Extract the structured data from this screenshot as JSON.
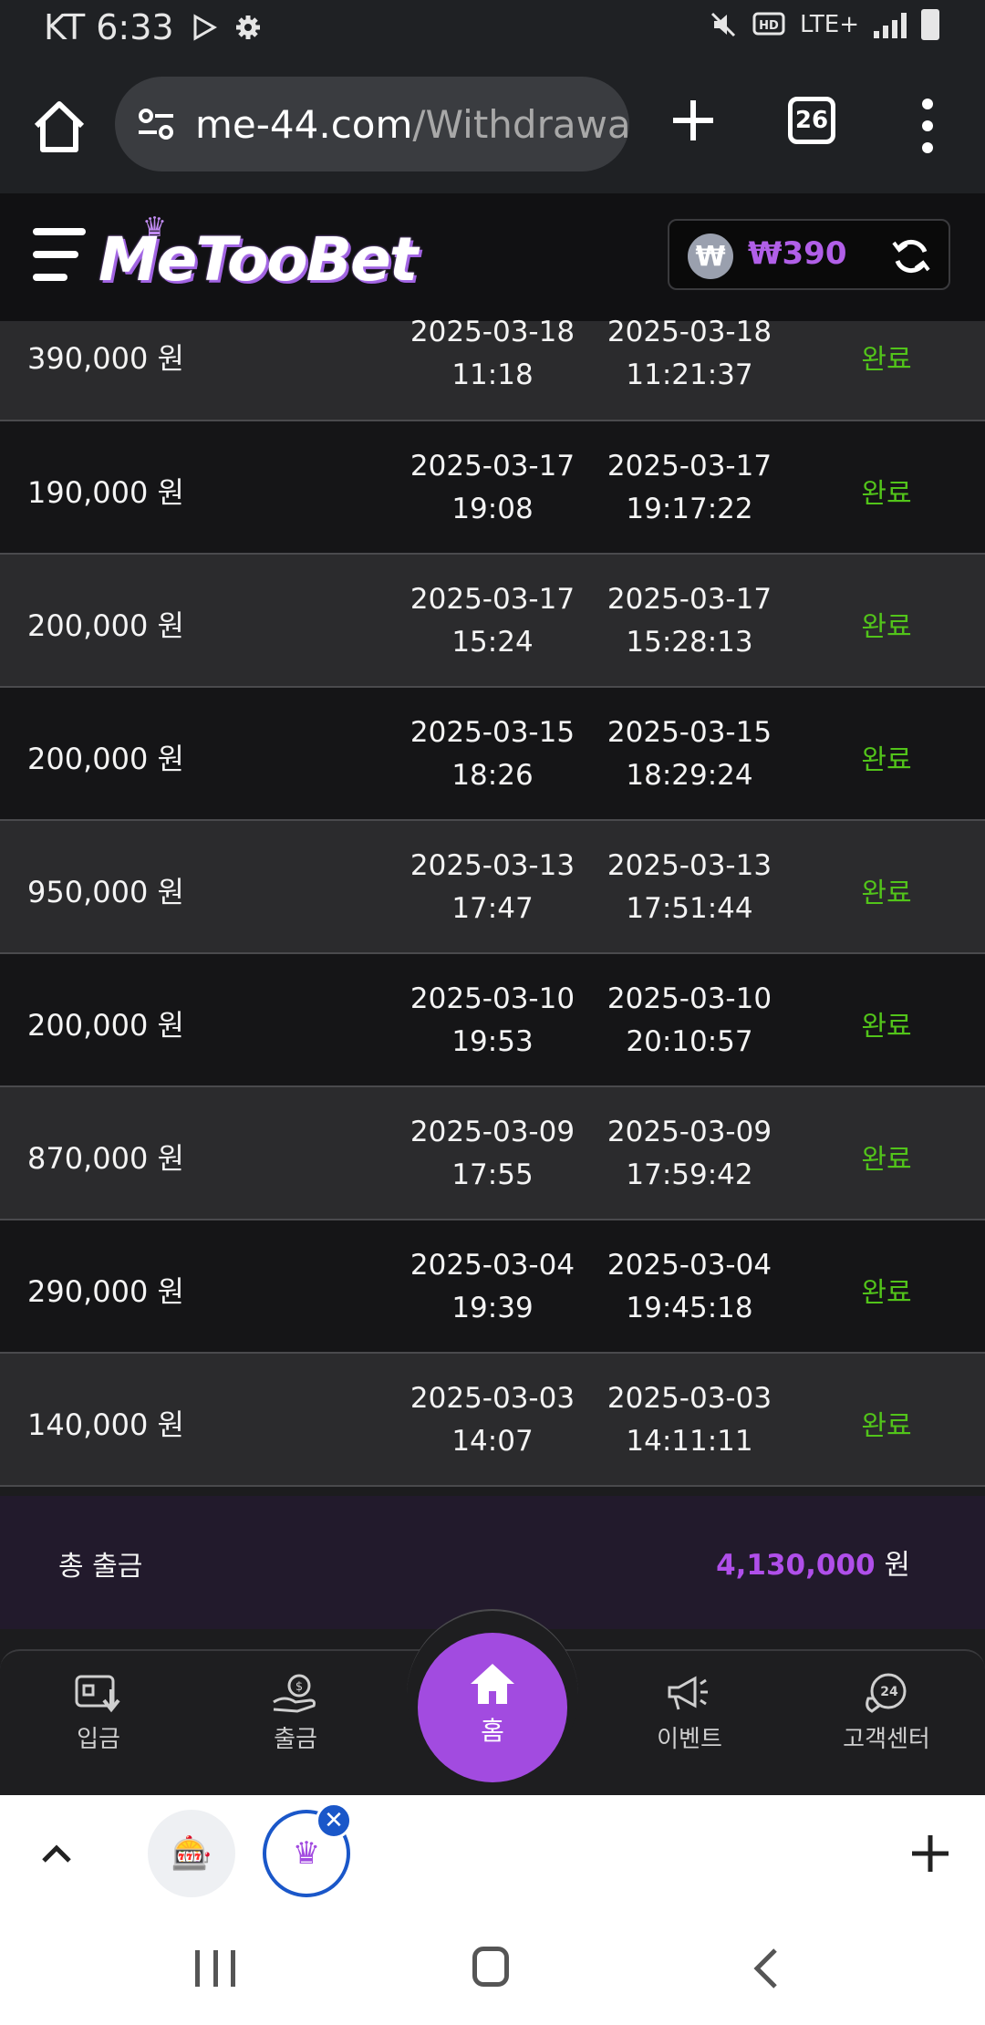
{
  "status_bar": {
    "carrier_time": "KT 6:33",
    "network": "LTE+"
  },
  "browser": {
    "url_domain": "me-44.com",
    "url_path": "/Withdrawal",
    "tab_count": "26"
  },
  "header": {
    "logo": "MeTooBet",
    "balance_symbol": "₩",
    "balance": "₩390"
  },
  "withdrawals": [
    {
      "amount": "390,000 원",
      "req_date": "2025-03-18",
      "req_time": "11:18",
      "done_date": "2025-03-18",
      "done_time": "11:21:37",
      "status": "완료"
    },
    {
      "amount": "190,000 원",
      "req_date": "2025-03-17",
      "req_time": "19:08",
      "done_date": "2025-03-17",
      "done_time": "19:17:22",
      "status": "완료"
    },
    {
      "amount": "200,000 원",
      "req_date": "2025-03-17",
      "req_time": "15:24",
      "done_date": "2025-03-17",
      "done_time": "15:28:13",
      "status": "완료"
    },
    {
      "amount": "200,000 원",
      "req_date": "2025-03-15",
      "req_time": "18:26",
      "done_date": "2025-03-15",
      "done_time": "18:29:24",
      "status": "완료"
    },
    {
      "amount": "950,000 원",
      "req_date": "2025-03-13",
      "req_time": "17:47",
      "done_date": "2025-03-13",
      "done_time": "17:51:44",
      "status": "완료"
    },
    {
      "amount": "200,000 원",
      "req_date": "2025-03-10",
      "req_time": "19:53",
      "done_date": "2025-03-10",
      "done_time": "20:10:57",
      "status": "완료"
    },
    {
      "amount": "870,000 원",
      "req_date": "2025-03-09",
      "req_time": "17:55",
      "done_date": "2025-03-09",
      "done_time": "17:59:42",
      "status": "완료"
    },
    {
      "amount": "290,000 원",
      "req_date": "2025-03-04",
      "req_time": "19:39",
      "done_date": "2025-03-04",
      "done_time": "19:45:18",
      "status": "완료"
    },
    {
      "amount": "140,000 원",
      "req_date": "2025-03-03",
      "req_time": "14:07",
      "done_date": "2025-03-03",
      "done_time": "14:11:11",
      "status": "완료"
    }
  ],
  "total": {
    "label": "총 출금",
    "value": "4,130,000",
    "unit": "원"
  },
  "bottom_nav": {
    "deposit": "입금",
    "withdraw": "출금",
    "home": "홈",
    "event": "이벤트",
    "support": "고객센터",
    "support_badge": "24"
  },
  "colors": {
    "accent": "#a24be0",
    "status_done": "#52c41a",
    "total_bg": "#221a2c"
  },
  "icons": [
    "home-icon",
    "site-settings-icon",
    "plus-icon",
    "tabs-icon",
    "more-icon",
    "menu-icon",
    "refresh-icon",
    "deposit-icon",
    "withdraw-icon",
    "megaphone-icon",
    "support-24-icon"
  ]
}
